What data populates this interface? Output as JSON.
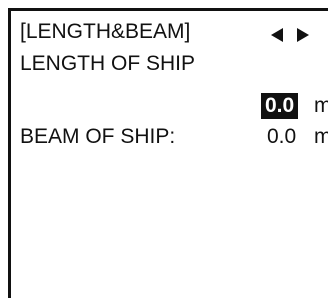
{
  "menu": {
    "title": "[LENGTH&BEAM]",
    "nav_icon": "left-right-arrows-icon"
  },
  "fields": {
    "length_label": "LENGTH OF SHIP",
    "length_value": "0.0",
    "length_unit": "m",
    "beam_label": "BEAM OF SHIP:",
    "beam_value": "0.0",
    "beam_unit": "m"
  },
  "colors": {
    "text": "#111111",
    "highlight_bg": "#111111",
    "highlight_text": "#ffffff",
    "background": "#ffffff"
  }
}
